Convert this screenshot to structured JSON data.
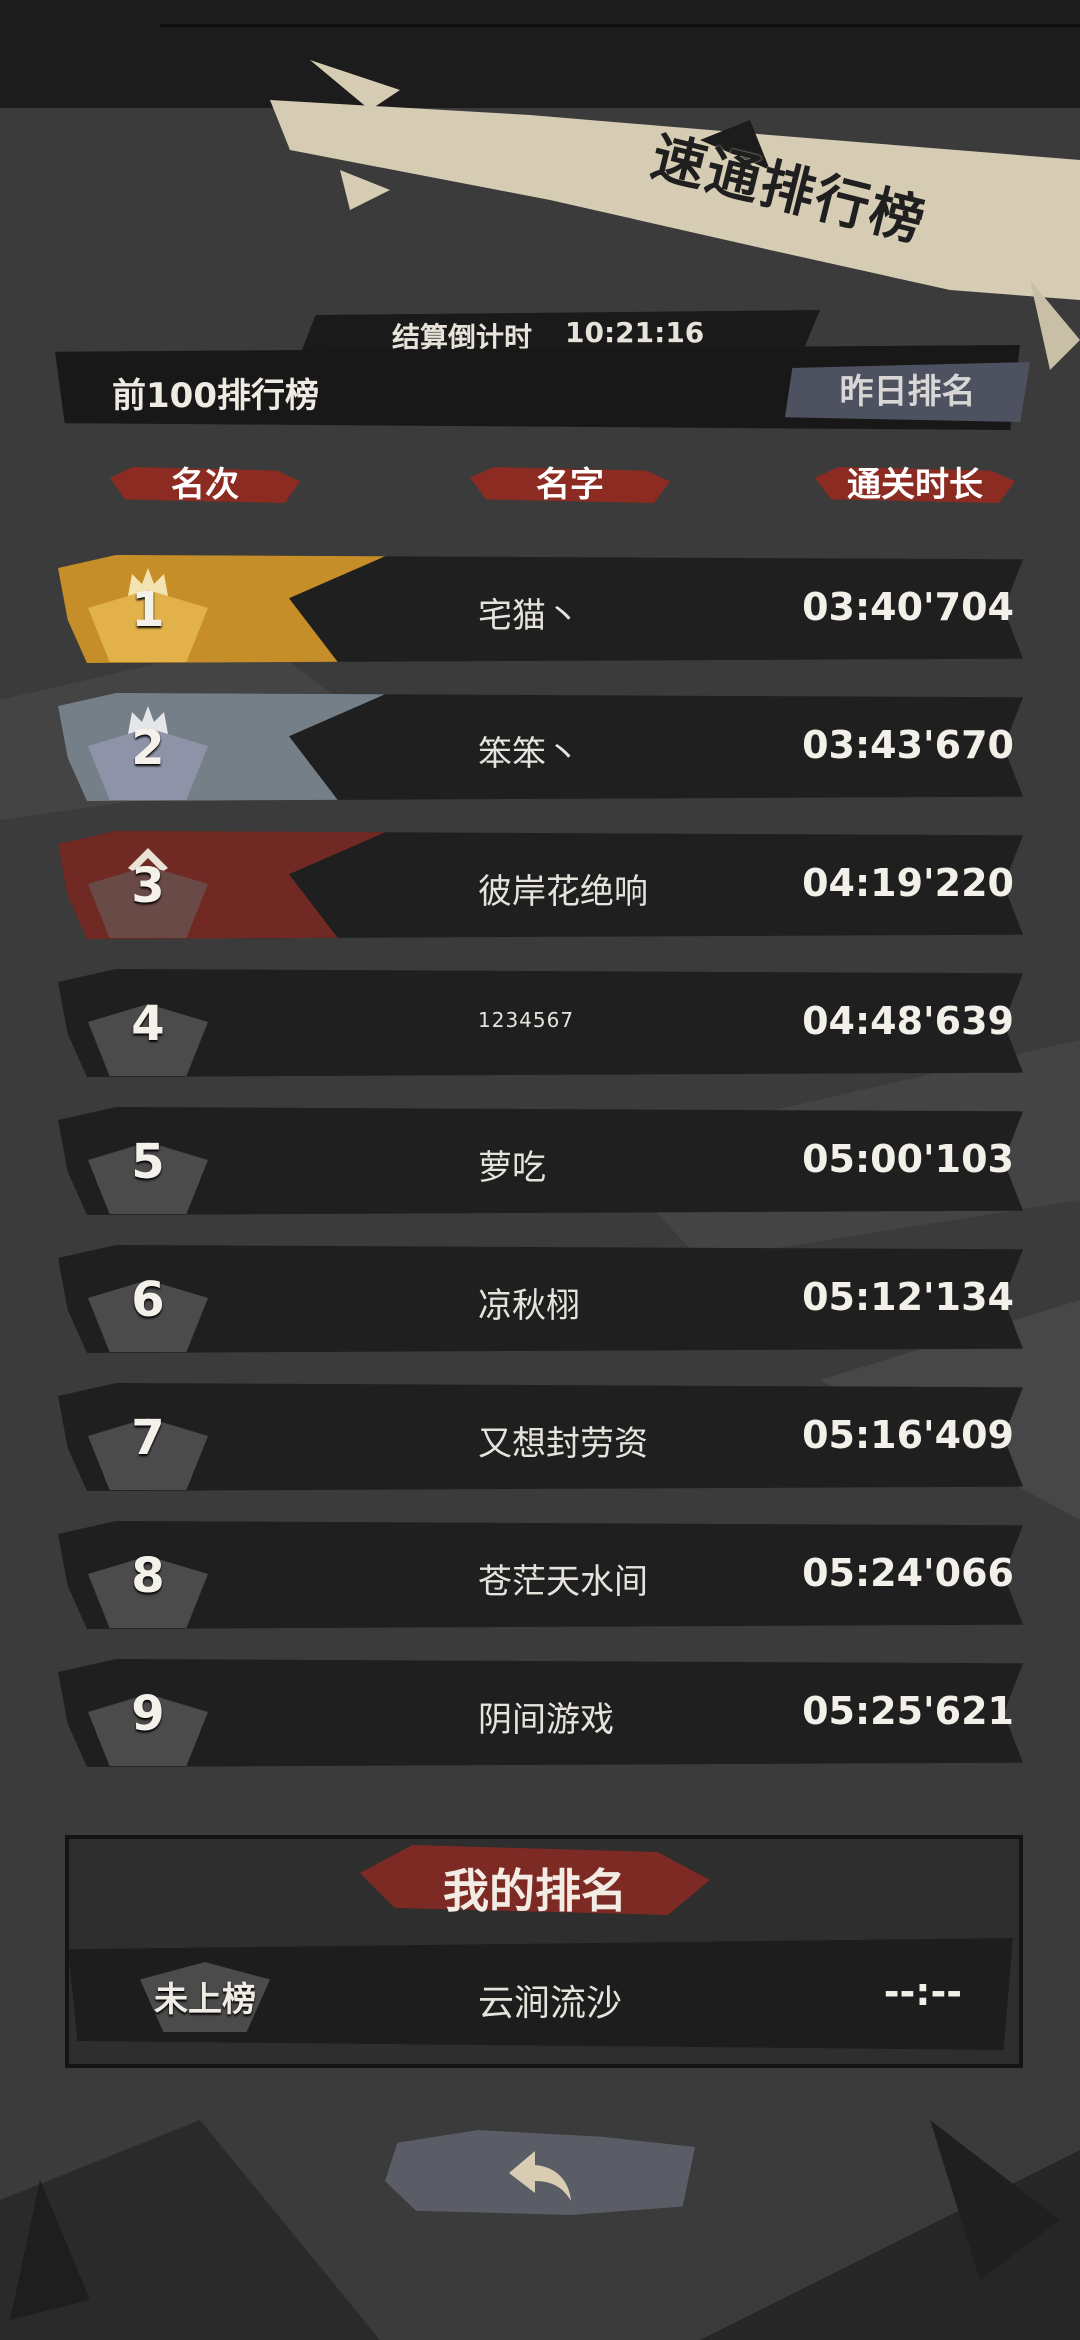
{
  "header": {
    "title": "速通排行榜",
    "countdown_label": "结算倒计时",
    "countdown_value": "10:21:16",
    "top100_label": "前100排行榜",
    "yesterday_button": "昨日排名"
  },
  "columns": {
    "rank": "名次",
    "name": "名字",
    "time": "通关时长"
  },
  "rows": [
    {
      "rank": "1",
      "name": "宅猫丶",
      "time": "03:40'704"
    },
    {
      "rank": "2",
      "name": "笨笨丶",
      "time": "03:43'670"
    },
    {
      "rank": "3",
      "name": "彼岸花绝响",
      "time": "04:19'220"
    },
    {
      "rank": "4",
      "name": "1234567",
      "time": "04:48'639"
    },
    {
      "rank": "5",
      "name": "萝吃",
      "time": "05:00'103"
    },
    {
      "rank": "6",
      "name": "凉秋栩",
      "time": "05:12'134"
    },
    {
      "rank": "7",
      "name": "又想封劳资",
      "time": "05:16'409"
    },
    {
      "rank": "8",
      "name": "苍茫天水间",
      "time": "05:24'066"
    },
    {
      "rank": "9",
      "name": "阴间游戏",
      "time": "05:25'621"
    }
  ],
  "my_rank": {
    "title": "我的排名",
    "rank": "未上榜",
    "name": "云涧流沙",
    "time": "--:--"
  },
  "colors": {
    "gold": "#d79a2a",
    "silver": "#8e9ba6",
    "bronze": "#8a2b24",
    "accent_red": "#8c2b22"
  }
}
